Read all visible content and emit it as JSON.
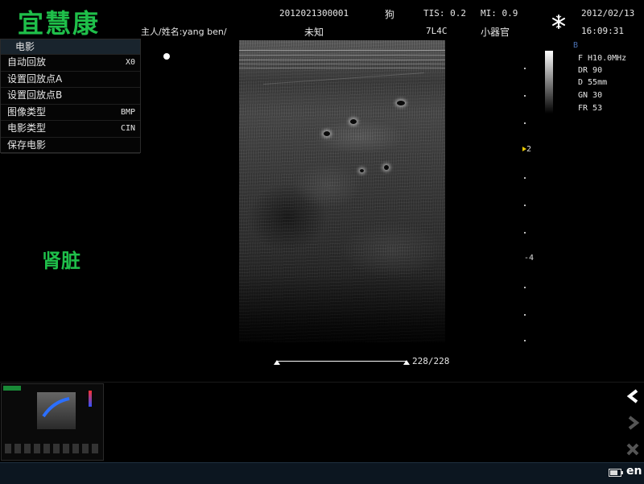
{
  "header": {
    "brand": "宜慧康",
    "patient_id": "2012021300001",
    "species": "狗",
    "tis": "TIS: 0.2",
    "mi": "MI: 0.9",
    "date": "2012/02/13",
    "owner_name": "主人/姓名:yang ben/",
    "sex": "未知",
    "probe": "7L4C",
    "preset": "小器官",
    "time": "16:09:31",
    "freeze_icon": "snowflake-icon"
  },
  "menu": {
    "title": "电影",
    "items": [
      {
        "label": "自动回放",
        "value": "X0"
      },
      {
        "label": "设置回放点A",
        "value": ""
      },
      {
        "label": "设置回放点B",
        "value": ""
      },
      {
        "label": "图像类型",
        "value": "BMP"
      },
      {
        "label": "电影类型",
        "value": "CIN"
      },
      {
        "label": "保存电影",
        "value": ""
      }
    ]
  },
  "organ_label": "肾脏",
  "depth_scale": {
    "labels": [
      "2",
      "-4"
    ]
  },
  "params": {
    "mode": "B",
    "freq": "F   H10.0MHz",
    "dr": "DR  90",
    "depth": "D   55mm",
    "gain": "GN  30",
    "frame_rate": "FR  53"
  },
  "cine": {
    "counter": "228/228",
    "frame": 228,
    "total": 228
  },
  "status": {
    "language": "en",
    "battery_icon": "battery-icon"
  },
  "controls": {
    "back_icon": "chevron-left-icon",
    "next_icon": "chevron-right-icon",
    "close_icon": "close-icon"
  },
  "colors": {
    "brand_green": "#1fbf4a",
    "menu_header": "#19242d",
    "status_bar": "#0c1620"
  }
}
